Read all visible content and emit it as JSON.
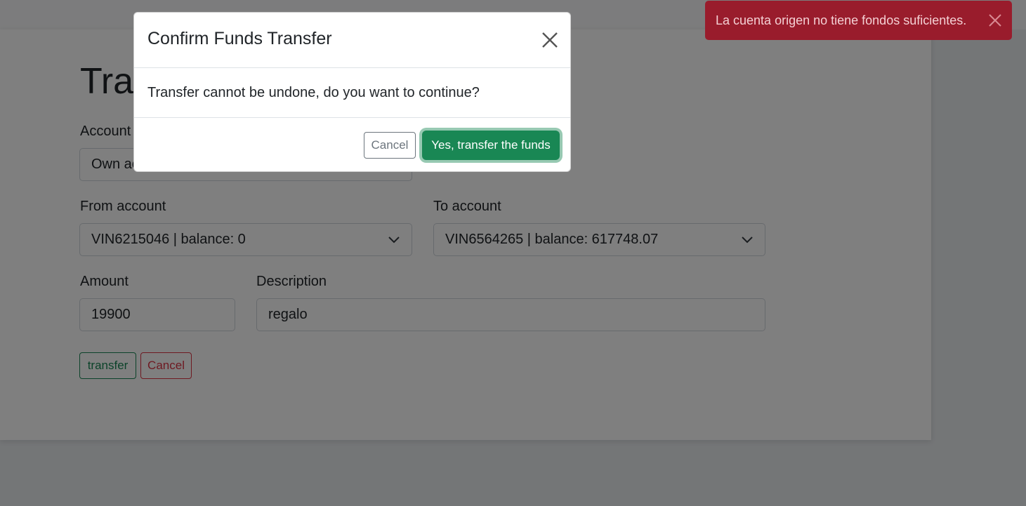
{
  "page": {
    "title": "Transfer",
    "account_label": "Account",
    "account_value": "Own account",
    "from_label": "From account",
    "from_value": "VIN6215046 | balance: 0",
    "to_label": "To account",
    "to_value": "VIN6564265 | balance: 617748.07",
    "amount_label": "Amount",
    "amount_value": "19900",
    "description_label": "Description",
    "description_value": "regalo",
    "transfer_button": "transfer",
    "cancel_button": "Cancel"
  },
  "modal": {
    "title": "Confirm Funds Transfer",
    "body": "Transfer cannot be undone, do you want to continue?",
    "cancel_label": "Cancel",
    "confirm_label": "Yes, transfer the funds",
    "close_icon": "close-icon"
  },
  "toast": {
    "message": "La cuenta origen no tiene fondos suficientes.",
    "close_icon": "close-icon",
    "color": "#991c2c"
  },
  "colors": {
    "success": "#198754",
    "danger": "#dc3545",
    "secondary": "#6c757d"
  }
}
